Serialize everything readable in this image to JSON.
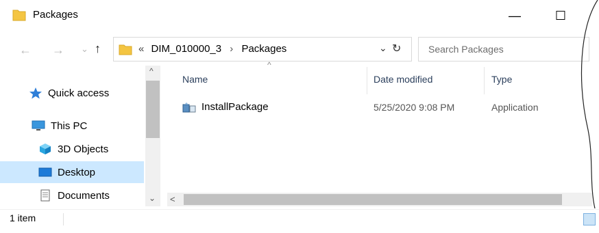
{
  "window": {
    "title": "Packages",
    "minimize_glyph": "—",
    "maximize_glyph": "☐"
  },
  "nav": {
    "back_glyph": "←",
    "forward_glyph": "→",
    "recent_glyph": "⌄",
    "up_glyph": "↑"
  },
  "address": {
    "overflow": "«",
    "segments": [
      "DIM_010000_3",
      "Packages"
    ],
    "separator": "›",
    "dropdown_glyph": "⌄",
    "refresh_glyph": "↻"
  },
  "search": {
    "placeholder": "Search Packages"
  },
  "sidebar": {
    "items": [
      {
        "label": "Quick access",
        "icon": "star-icon"
      },
      {
        "label": "This PC",
        "icon": "computer-icon"
      },
      {
        "label": "3D Objects",
        "icon": "cube-icon"
      },
      {
        "label": "Desktop",
        "icon": "desktop-icon",
        "selected": true
      },
      {
        "label": "Documents",
        "icon": "document-icon"
      }
    ]
  },
  "columns": {
    "name": "Name",
    "date": "Date modified",
    "type": "Type",
    "sort_glyph": "^"
  },
  "files": [
    {
      "name": "InstallPackage",
      "date": "5/25/2020 9:08 PM",
      "type": "Application",
      "icon": "application-icon"
    }
  ],
  "status": {
    "count": "1 item"
  },
  "scroll": {
    "up_glyph": "^",
    "down_glyph": "⌄",
    "left_glyph": "<"
  },
  "colors": {
    "folder": "#f4c542",
    "selection": "#cce8ff",
    "accent": "#0078d7"
  }
}
